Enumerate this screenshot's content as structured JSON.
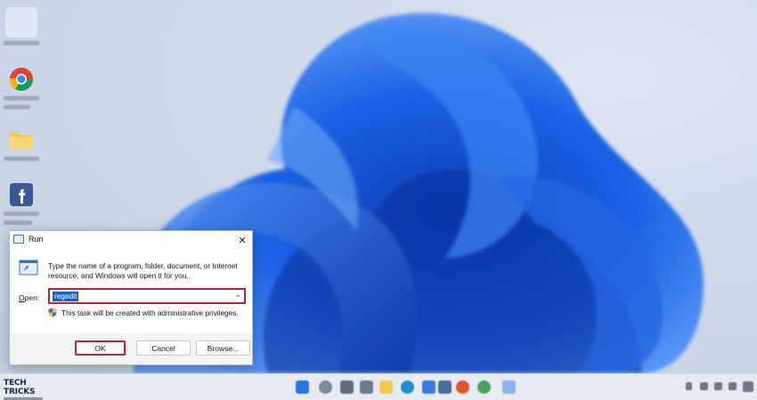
{
  "dialog": {
    "title": "Run",
    "close_glyph": "✕",
    "description": "Type the name of a program, folder, document, or Internet resource, and Windows will open it for you.",
    "open_label_prefix": "O",
    "open_label_rest": "pen:",
    "input_value": "regedit",
    "dropdown_glyph": "⌄",
    "admin_note": "This task will be created with administrative privileges.",
    "ok_label": "OK",
    "cancel_label": "Cancel",
    "browse_label": "Browse..."
  },
  "watermark": {
    "brand": "TECH TRICKS"
  },
  "icons": {
    "run": "run-icon",
    "shield": "uac-shield-icon",
    "close": "close-icon"
  },
  "colors": {
    "highlight_border": "#b3262f",
    "selection": "#1b5fc4",
    "wallpaper_blue": "#1a5be0"
  }
}
